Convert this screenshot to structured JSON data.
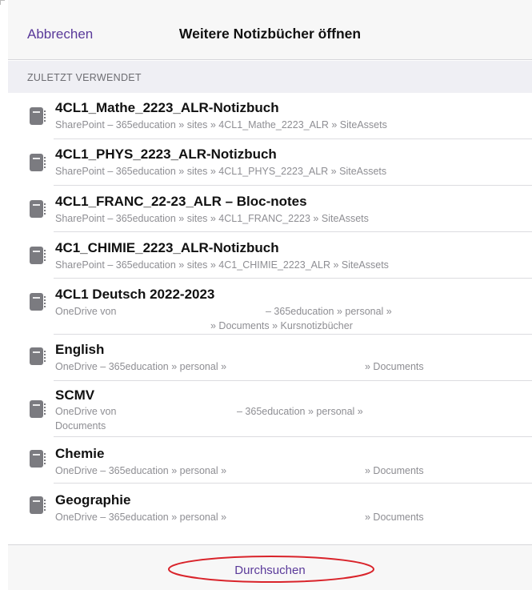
{
  "header": {
    "cancel_label": "Abbrechen",
    "title": "Weitere Notizbücher öffnen"
  },
  "section": {
    "title": "ZULETZT VERWENDET"
  },
  "notebooks": [
    {
      "name": "4CL1_Mathe_2223_ALR-Notizbuch",
      "path": "SharePoint – 365education » sites » 4CL1_Mathe_2223_ALR » SiteAssets"
    },
    {
      "name": "4CL1_PHYS_2223_ALR-Notizbuch",
      "path": "SharePoint – 365education » sites » 4CL1_PHYS_2223_ALR » SiteAssets"
    },
    {
      "name": "4CL1_FRANC_22-23_ALR – Bloc-notes",
      "path": "SharePoint – 365education » sites » 4CL1_FRANC_2223 » SiteAssets"
    },
    {
      "name": "4C1_CHIMIE_2223_ALR-Notizbuch",
      "path": "SharePoint – 365education » sites » 4C1_CHIMIE_2223_ALR » SiteAssets"
    },
    {
      "name": "4CL1 Deutsch 2022-2023",
      "path_a": "OneDrive von",
      "path_b": "– 365education » personal »",
      "path_c": "» Documents » Kursnotizbücher"
    },
    {
      "name": "English",
      "path_a": "OneDrive – 365education » personal »",
      "path_b": "» Documents"
    },
    {
      "name": "SCMV",
      "path_a": "OneDrive von",
      "path_b": "– 365education » personal »",
      "path_c": "Documents"
    },
    {
      "name": "Chemie",
      "path_a": "OneDrive – 365education » personal »",
      "path_b": "» Documents"
    },
    {
      "name": "Geographie",
      "path_a": "OneDrive – 365education » personal »",
      "path_b": "» Documents"
    }
  ],
  "footer": {
    "browse_label": "Durchsuchen"
  },
  "colors": {
    "accent": "#5a3a9a",
    "annotation_ellipse": "#d9232a"
  },
  "icons": {
    "notebook": "notebook-icon"
  }
}
